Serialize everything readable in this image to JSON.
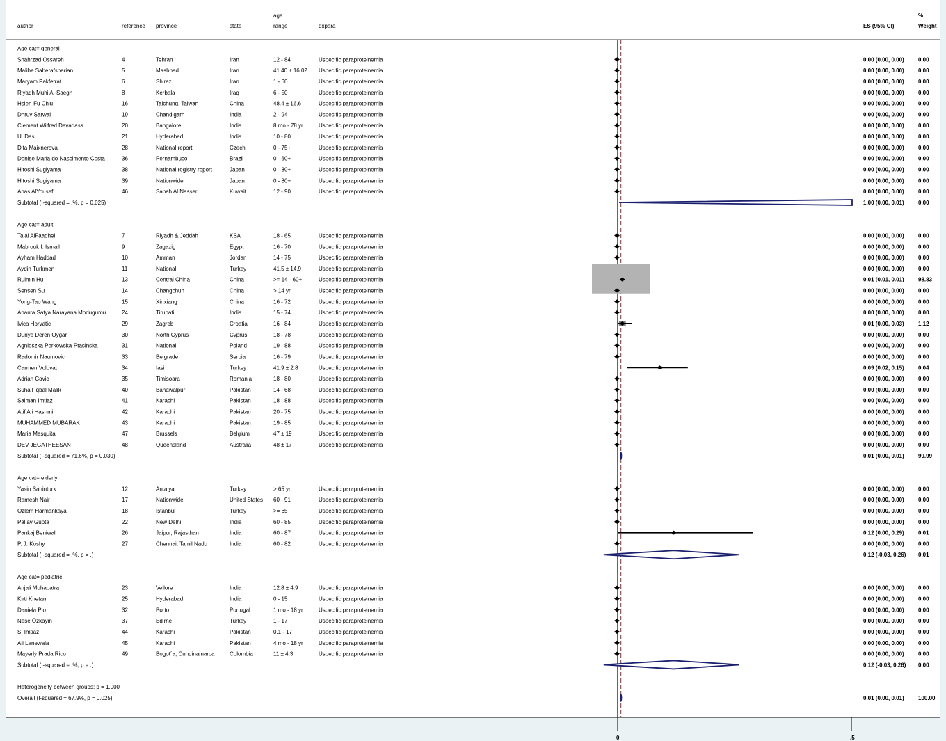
{
  "headers": {
    "author": "author",
    "reference": "reference",
    "province": "province",
    "state": "state",
    "age_top": "age",
    "age_bottom": "range",
    "dxpara": "dxpara",
    "es": "ES (95% CI)",
    "weight_top": "%",
    "weight_bottom": "Weight"
  },
  "chart_data": {
    "type": "forest",
    "xaxis": {
      "ticks": [
        0,
        0.5
      ],
      "tick_labels": [
        "0",
        ".5"
      ],
      "null_line": 0,
      "overall_line": 0.01
    },
    "groups": [
      {
        "label": "Age cat= general",
        "studies": [
          {
            "author": "Shahrzad Ossareh",
            "reference": "4",
            "province": "Tehran",
            "state": "Iran",
            "age": "12 - 84",
            "dxpara": "Uspecific paraproteinemia",
            "es": 0.0,
            "lo": 0.0,
            "hi": 0.0,
            "es_text": "0.00 (0.00, 0.00)",
            "weight": "0.00"
          },
          {
            "author": "Malihe Saberafsharian",
            "reference": "5",
            "province": "Mashhad",
            "state": "Iran",
            "age": "41.40 ± 16.02",
            "dxpara": "Uspecific paraproteinemia",
            "es": 0.0,
            "lo": 0.0,
            "hi": 0.0,
            "es_text": "0.00 (0.00, 0.00)",
            "weight": "0.00"
          },
          {
            "author": "Maryam Pakfetrat",
            "reference": "6",
            "province": "Shiraz",
            "state": "Iran",
            "age": "1 - 60",
            "dxpara": "Uspecific paraproteinemia",
            "es": 0.0,
            "lo": 0.0,
            "hi": 0.0,
            "es_text": "0.00 (0.00, 0.00)",
            "weight": "0.00"
          },
          {
            "author": "Riyadh Muhi Al-Saegh",
            "reference": "8",
            "province": "Kerbala",
            "state": "Iraq",
            "age": "6 - 50",
            "dxpara": "Uspecific paraproteinemia",
            "es": 0.0,
            "lo": 0.0,
            "hi": 0.0,
            "es_text": "0.00 (0.00, 0.00)",
            "weight": "0.00"
          },
          {
            "author": "Hsien-Fu Chiu",
            "reference": "16",
            "province": "Taichung, Taiwan",
            "state": "China",
            "age": "48.4 ± 16.6",
            "dxpara": "Uspecific paraproteinemia",
            "es": 0.0,
            "lo": 0.0,
            "hi": 0.0,
            "es_text": "0.00 (0.00, 0.00)",
            "weight": "0.00"
          },
          {
            "author": "Dhruv Sarwal",
            "reference": "19",
            "province": "Chandigarh",
            "state": "India",
            "age": "2 - 94",
            "dxpara": "Uspecific paraproteinemia",
            "es": 0.0,
            "lo": 0.0,
            "hi": 0.0,
            "es_text": "0.00 (0.00, 0.00)",
            "weight": "0.00"
          },
          {
            "author": "Clement Wilfred Devadass",
            "reference": "20",
            "province": "Bangalore",
            "state": "India",
            "age": "8 mo - 78 yr",
            "dxpara": "Uspecific paraproteinemia",
            "es": 0.0,
            "lo": 0.0,
            "hi": 0.0,
            "es_text": "0.00 (0.00, 0.00)",
            "weight": "0.00"
          },
          {
            "author": "U. Das",
            "reference": "21",
            "province": "Hyderabad",
            "state": "India",
            "age": "10 - 80",
            "dxpara": "Uspecific paraproteinemia",
            "es": 0.0,
            "lo": 0.0,
            "hi": 0.0,
            "es_text": "0.00 (0.00, 0.00)",
            "weight": "0.00"
          },
          {
            "author": "Dita Maixnerova",
            "reference": "28",
            "province": "National report",
            "state": "Czech",
            "age": "0 - 75+",
            "dxpara": "Uspecific paraproteinemia",
            "es": 0.0,
            "lo": 0.0,
            "hi": 0.0,
            "es_text": "0.00 (0.00, 0.00)",
            "weight": "0.00"
          },
          {
            "author": "Denise Maria do Nascimento Costa",
            "reference": "36",
            "province": "Pernambuco",
            "state": "Brazil",
            "age": "0 - 60+",
            "dxpara": "Uspecific paraproteinemia",
            "es": 0.0,
            "lo": 0.0,
            "hi": 0.0,
            "es_text": "0.00 (0.00, 0.00)",
            "weight": "0.00"
          },
          {
            "author": "Hitoshi Sugiyama",
            "reference": "38",
            "province": "National registry report",
            "state": "Japan",
            "age": "0 - 80+",
            "dxpara": "Uspecific paraproteinemia",
            "es": 0.0,
            "lo": 0.0,
            "hi": 0.0,
            "es_text": "0.00 (0.00, 0.00)",
            "weight": "0.00"
          },
          {
            "author": "Hitoshi Sugiyama",
            "reference": "39",
            "province": "Nationwide",
            "state": "Japan",
            "age": "0 - 80+",
            "dxpara": "Uspecific paraproteinemia",
            "es": 0.0,
            "lo": 0.0,
            "hi": 0.0,
            "es_text": "0.00 (0.00, 0.00)",
            "weight": "0.00"
          },
          {
            "author": "Anas AlYousef",
            "reference": "46",
            "province": "Sabah Al Nasser",
            "state": "Kuwait",
            "age": "12 - 90",
            "dxpara": "Uspecific paraproteinemia",
            "es": 0.0,
            "lo": 0.0,
            "hi": 0.0,
            "es_text": "0.00 (0.00, 0.00)",
            "weight": "0.00"
          }
        ],
        "subtotal": {
          "label": "Subtotal  (I-squared = .%, p = 0.025)",
          "es": 1.0,
          "lo": 0.0,
          "hi": 0.01,
          "es_text": "1.00 (0.00, 0.01)",
          "weight": "0.00"
        }
      },
      {
        "label": "Age cat= adult",
        "studies": [
          {
            "author": "Talal AlFaadhel",
            "reference": "7",
            "province": "Riyadh & Jeddah",
            "state": "KSA",
            "age": "18 - 65",
            "dxpara": "Uspecific paraproteinemia",
            "es": 0.0,
            "lo": 0.0,
            "hi": 0.0,
            "es_text": "0.00 (0.00, 0.00)",
            "weight": "0.00"
          },
          {
            "author": "Mabrouk I. Ismail",
            "reference": "9",
            "province": "Zagazig",
            "state": "Egypt",
            "age": "16 - 70",
            "dxpara": "Uspecific paraproteinemia",
            "es": 0.0,
            "lo": 0.0,
            "hi": 0.0,
            "es_text": "0.00 (0.00, 0.00)",
            "weight": "0.00"
          },
          {
            "author": "Ayham Haddad",
            "reference": "10",
            "province": "Amman",
            "state": "Jordan",
            "age": "14 - 75",
            "dxpara": "Uspecific paraproteinemia",
            "es": 0.0,
            "lo": 0.0,
            "hi": 0.0,
            "es_text": "0.00 (0.00, 0.00)",
            "weight": "0.00"
          },
          {
            "author": "Aydin Turkmen",
            "reference": "11",
            "province": "National",
            "state": "Turkey",
            "age": "41.5 ± 14.9",
            "dxpara": "Uspecific paraproteinemia",
            "es": 0.0,
            "lo": 0.0,
            "hi": 0.0,
            "es_text": "0.00 (0.00, 0.00)",
            "weight": "0.00"
          },
          {
            "author": "Ruimin Hu",
            "reference": "13",
            "province": "Central China",
            "state": "China",
            "age": ">= 14 - 60+",
            "dxpara": "Uspecific paraproteinemia",
            "es": 0.01,
            "lo": 0.01,
            "hi": 0.01,
            "es_text": "0.01 (0.01, 0.01)",
            "weight": "98.83"
          },
          {
            "author": "Sensen Su",
            "reference": "14",
            "province": "Changchun",
            "state": "China",
            "age": "> 14 yr",
            "dxpara": "Uspecific paraproteinemia",
            "es": 0.0,
            "lo": 0.0,
            "hi": 0.0,
            "es_text": "0.00 (0.00, 0.00)",
            "weight": "0.00"
          },
          {
            "author": "Yong-Tao Wang",
            "reference": "15",
            "province": "Xinxiang",
            "state": "China",
            "age": "16 - 72",
            "dxpara": "Uspecific paraproteinemia",
            "es": 0.0,
            "lo": 0.0,
            "hi": 0.0,
            "es_text": "0.00 (0.00, 0.00)",
            "weight": "0.00"
          },
          {
            "author": "Ananta Satya Narayana Modugumu",
            "reference": "24",
            "province": "Tirupati",
            "state": "India",
            "age": "15 - 74",
            "dxpara": "Uspecific paraproteinemia",
            "es": 0.0,
            "lo": 0.0,
            "hi": 0.0,
            "es_text": "0.00 (0.00, 0.00)",
            "weight": "0.00"
          },
          {
            "author": "Ivica Horvatic",
            "reference": "29",
            "province": "Zagreb",
            "state": "Croatia",
            "age": "16 - 84",
            "dxpara": "Uspecific paraproteinemia",
            "es": 0.01,
            "lo": 0.0,
            "hi": 0.03,
            "es_text": "0.01 (0.00, 0.03)",
            "weight": "1.12"
          },
          {
            "author": "Düriye Deren Oygar",
            "reference": "30",
            "province": "North Cyprus",
            "state": "Cyprus",
            "age": "18 - 78",
            "dxpara": "Uspecific paraproteinemia",
            "es": 0.0,
            "lo": 0.0,
            "hi": 0.0,
            "es_text": "0.00 (0.00, 0.00)",
            "weight": "0.00"
          },
          {
            "author": "Agnieszka Perkowska-Ptasinska",
            "reference": "31",
            "province": "National",
            "state": "Poland",
            "age": "19 - 88",
            "dxpara": "Uspecific paraproteinemia",
            "es": 0.0,
            "lo": 0.0,
            "hi": 0.0,
            "es_text": "0.00 (0.00, 0.00)",
            "weight": "0.00"
          },
          {
            "author": "Radomir Naumovic",
            "reference": "33",
            "province": "Belgrade",
            "state": "Serbia",
            "age": "16 - 79",
            "dxpara": "Uspecific paraproteinemia",
            "es": 0.0,
            "lo": 0.0,
            "hi": 0.0,
            "es_text": "0.00 (0.00, 0.00)",
            "weight": "0.00"
          },
          {
            "author": "Carmen Volovat",
            "reference": "34",
            "province": "Iasi",
            "state": "Turkey",
            "age": "41.9 ± 2.8",
            "dxpara": "Uspecific paraproteinemia",
            "es": 0.09,
            "lo": 0.02,
            "hi": 0.15,
            "es_text": "0.09 (0.02, 0.15)",
            "weight": "0.04"
          },
          {
            "author": "Adrian Covic",
            "reference": "35",
            "province": "Timisoara",
            "state": "Romania",
            "age": "18 - 80",
            "dxpara": "Uspecific paraproteinemia",
            "es": 0.0,
            "lo": 0.0,
            "hi": 0.0,
            "es_text": "0.00 (0.00, 0.00)",
            "weight": "0.00"
          },
          {
            "author": "Suhail Iqbal Malik",
            "reference": "40",
            "province": "Bahawalpur",
            "state": "Pakistan",
            "age": "14 - 68",
            "dxpara": "Uspecific paraproteinemia",
            "es": 0.0,
            "lo": 0.0,
            "hi": 0.0,
            "es_text": "0.00 (0.00, 0.00)",
            "weight": "0.00"
          },
          {
            "author": "Salman Imtiaz",
            "reference": "41",
            "province": "Karachi",
            "state": "Pakistan",
            "age": "18 - 88",
            "dxpara": "Uspecific paraproteinemia",
            "es": 0.0,
            "lo": 0.0,
            "hi": 0.0,
            "es_text": "0.00 (0.00, 0.00)",
            "weight": "0.00"
          },
          {
            "author": "Atif Ali Hashmi",
            "reference": "42",
            "province": "Karachi",
            "state": "Pakistan",
            "age": "20 - 75",
            "dxpara": "Uspecific paraproteinemia",
            "es": 0.0,
            "lo": 0.0,
            "hi": 0.0,
            "es_text": "0.00 (0.00, 0.00)",
            "weight": "0.00"
          },
          {
            "author": "MUHAMMED MUBARAK",
            "reference": "43",
            "province": "Karachi",
            "state": "Pakistan",
            "age": "19 - 85",
            "dxpara": "Uspecific paraproteinemia",
            "es": 0.0,
            "lo": 0.0,
            "hi": 0.0,
            "es_text": "0.00 (0.00, 0.00)",
            "weight": "0.00"
          },
          {
            "author": "Maria Mesquita",
            "reference": "47",
            "province": "Brussels",
            "state": "Belgium",
            "age": "47 ± 19",
            "dxpara": "Uspecific paraproteinemia",
            "es": 0.0,
            "lo": 0.0,
            "hi": 0.0,
            "es_text": "0.00 (0.00, 0.00)",
            "weight": "0.00"
          },
          {
            "author": "DEV JEGATHEESAN",
            "reference": "48",
            "province": "Queensland",
            "state": "Australia",
            "age": "48 ± 17",
            "dxpara": "Uspecific paraproteinemia",
            "es": 0.0,
            "lo": 0.0,
            "hi": 0.0,
            "es_text": "0.00 (0.00, 0.00)",
            "weight": "0.00"
          }
        ],
        "subtotal": {
          "label": "Subtotal  (I-squared = 71.6%, p = 0.030)",
          "es": 0.01,
          "lo": 0.01,
          "hi": 0.01,
          "es_text": "0.01 (0.00, 0.01)",
          "weight": "99.99"
        }
      },
      {
        "label": "Age cat= elderly",
        "studies": [
          {
            "author": "Yasin Sahinturk",
            "reference": "12",
            "province": "Antalya",
            "state": "Turkey",
            "age": "> 65 yr",
            "dxpara": "Uspecific paraproteinemia",
            "es": 0.0,
            "lo": 0.0,
            "hi": 0.0,
            "es_text": "0.00 (0.00, 0.00)",
            "weight": "0.00"
          },
          {
            "author": "Ramesh Nair",
            "reference": "17",
            "province": "Nationwide",
            "state": "United States",
            "age": "60 - 91",
            "dxpara": "Uspecific paraproteinemia",
            "es": 0.0,
            "lo": 0.0,
            "hi": 0.0,
            "es_text": "0.00 (0.00, 0.00)",
            "weight": "0.00"
          },
          {
            "author": "Ozlem Harmankaya",
            "reference": "18",
            "province": "Istanbul",
            "state": "Turkey",
            "age": ">= 65",
            "dxpara": "Uspecific paraproteinemia",
            "es": 0.0,
            "lo": 0.0,
            "hi": 0.0,
            "es_text": "0.00 (0.00, 0.00)",
            "weight": "0.00"
          },
          {
            "author": "Pallav Gupta",
            "reference": "22",
            "province": "New Delhi",
            "state": "India",
            "age": "60 - 85",
            "dxpara": "Uspecific paraproteinemia",
            "es": 0.0,
            "lo": 0.0,
            "hi": 0.0,
            "es_text": "0.00 (0.00, 0.00)",
            "weight": "0.00"
          },
          {
            "author": "Pankaj Beniwal",
            "reference": "26",
            "province": "Jaipur, Rajasthan",
            "state": "India",
            "age": "60 - 87",
            "dxpara": "Uspecific paraproteinemia",
            "es": 0.12,
            "lo": 0.0,
            "hi": 0.29,
            "es_text": "0.12 (0.00, 0.29)",
            "weight": "0.01"
          },
          {
            "author": "P. J. Koshy",
            "reference": "27",
            "province": "Chennai, Tamil Nadu",
            "state": "India",
            "age": "60 - 82",
            "dxpara": "Uspecific paraproteinemia",
            "es": 0.0,
            "lo": 0.0,
            "hi": 0.0,
            "es_text": "0.00 (0.00, 0.00)",
            "weight": "0.00"
          }
        ],
        "subtotal": {
          "label": "Subtotal  (I-squared = .%, p = .)",
          "es": 0.12,
          "lo": -0.03,
          "hi": 0.26,
          "es_text": "0.12 (-0.03, 0.26)",
          "weight": "0.01"
        }
      },
      {
        "label": "Age cat= pediatric",
        "studies": [
          {
            "author": "Anjali Mohapatra",
            "reference": "23",
            "province": "Vellore",
            "state": "India",
            "age": "12.8 ± 4.9",
            "dxpara": "Uspecific paraproteinemia",
            "es": 0.0,
            "lo": 0.0,
            "hi": 0.0,
            "es_text": "0.00 (0.00, 0.00)",
            "weight": "0.00"
          },
          {
            "author": "Kirti Khetan",
            "reference": "25",
            "province": "Hyderabad",
            "state": "India",
            "age": "0 - 15",
            "dxpara": "Uspecific paraproteinemia",
            "es": 0.0,
            "lo": 0.0,
            "hi": 0.0,
            "es_text": "0.00 (0.00, 0.00)",
            "weight": "0.00"
          },
          {
            "author": "Daniela Pio",
            "reference": "32",
            "province": "Porto",
            "state": "Portugal",
            "age": "1 mo - 18 yr",
            "dxpara": "Uspecific paraproteinemia",
            "es": 0.0,
            "lo": 0.0,
            "hi": 0.0,
            "es_text": "0.00 (0.00, 0.00)",
            "weight": "0.00"
          },
          {
            "author": "Nese Özkayin",
            "reference": "37",
            "province": "Edirne",
            "state": "Turkey",
            "age": "1 - 17",
            "dxpara": "Uspecific paraproteinemia",
            "es": 0.0,
            "lo": 0.0,
            "hi": 0.0,
            "es_text": "0.00 (0.00, 0.00)",
            "weight": "0.00"
          },
          {
            "author": "S. Imtiaz",
            "reference": "44",
            "province": "Karachi",
            "state": "Pakistan",
            "age": "0.1 - 17",
            "dxpara": "Uspecific paraproteinemia",
            "es": 0.0,
            "lo": 0.0,
            "hi": 0.0,
            "es_text": "0.00 (0.00, 0.00)",
            "weight": "0.00"
          },
          {
            "author": "Ali Lanewala",
            "reference": "45",
            "province": "Karachi",
            "state": "Pakistan",
            "age": "4 mo - 18 yr",
            "dxpara": "Uspecific paraproteinemia",
            "es": 0.0,
            "lo": 0.0,
            "hi": 0.0,
            "es_text": "0.00 (0.00, 0.00)",
            "weight": "0.00"
          },
          {
            "author": "Mayerly Prada Rico",
            "reference": "49",
            "province": "Bogot´a, Cundinamarca",
            "state": "Colombia",
            "age": "11 ± 4.3",
            "dxpara": "Uspecific paraproteinemia",
            "es": 0.0,
            "lo": 0.0,
            "hi": 0.0,
            "es_text": "0.00 (0.00, 0.00)",
            "weight": "0.00"
          }
        ],
        "subtotal": {
          "label": "Subtotal  (I-squared = .%, p = .)",
          "es": 0.12,
          "lo": -0.03,
          "hi": 0.26,
          "es_text": "0.12 (-0.03, 0.26)",
          "weight": "0.00"
        }
      }
    ],
    "heterogeneity": "Heterogeneity between groups: p = 1.000",
    "overall": {
      "label": "Overall  (I-squared = 67.9%, p = 0.025)",
      "es": 0.01,
      "lo": 0.01,
      "hi": 0.01,
      "es_text": "0.01 (0.00, 0.01)",
      "weight": "100.00"
    }
  }
}
